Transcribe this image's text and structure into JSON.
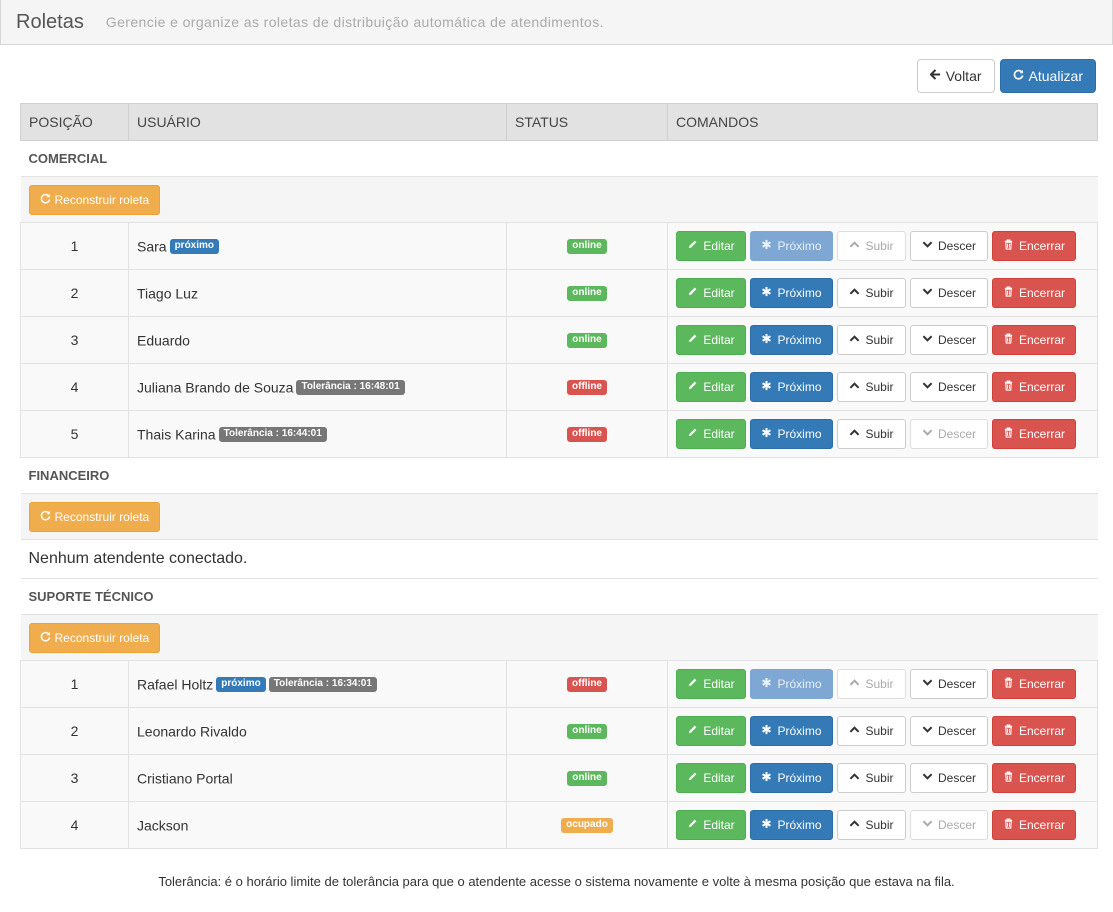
{
  "header": {
    "title": "Roletas",
    "subtitle": "Gerencie e organize as roletas de distribuição automática de atendimentos."
  },
  "toolbar": {
    "back_label": "Voltar",
    "refresh_label": "Atualizar"
  },
  "table": {
    "columns": [
      "POSIÇÃO",
      "USUÁRIO",
      "STATUS",
      "COMANDOS"
    ],
    "rebuild_label": "Reconstruir roleta",
    "empty_message": "Nenhum atendente conectado.",
    "commands": {
      "edit": "Editar",
      "next": "Próximo",
      "up": "Subir",
      "down": "Descer",
      "end": "Encerrar"
    }
  },
  "groups": [
    {
      "name": "COMERCIAL",
      "users": [
        {
          "pos": "1",
          "name": "Sara",
          "next_badge": "próximo",
          "tolerance": "",
          "status": "online",
          "next_disabled": true,
          "up_disabled": true,
          "down_disabled": false
        },
        {
          "pos": "2",
          "name": "Tiago Luz",
          "next_badge": "",
          "tolerance": "",
          "status": "online",
          "next_disabled": false,
          "up_disabled": false,
          "down_disabled": false
        },
        {
          "pos": "3",
          "name": "Eduardo",
          "next_badge": "",
          "tolerance": "",
          "status": "online",
          "next_disabled": false,
          "up_disabled": false,
          "down_disabled": false
        },
        {
          "pos": "4",
          "name": "Juliana Brando de Souza",
          "next_badge": "",
          "tolerance": "Tolerância : 16:48:01",
          "status": "offline",
          "next_disabled": false,
          "up_disabled": false,
          "down_disabled": false
        },
        {
          "pos": "5",
          "name": "Thais Karina",
          "next_badge": "",
          "tolerance": "Tolerância : 16:44:01",
          "status": "offline",
          "next_disabled": false,
          "up_disabled": false,
          "down_disabled": true
        }
      ]
    },
    {
      "name": "FINANCEIRO",
      "users": []
    },
    {
      "name": "SUPORTE TÉCNICO",
      "users": [
        {
          "pos": "1",
          "name": "Rafael Holtz",
          "next_badge": "próximo",
          "tolerance": "Tolerância : 16:34:01",
          "status": "offline",
          "next_disabled": true,
          "up_disabled": true,
          "down_disabled": false
        },
        {
          "pos": "2",
          "name": "Leonardo Rivaldo",
          "next_badge": "",
          "tolerance": "",
          "status": "online",
          "next_disabled": false,
          "up_disabled": false,
          "down_disabled": false
        },
        {
          "pos": "3",
          "name": "Cristiano Portal",
          "next_badge": "",
          "tolerance": "",
          "status": "online",
          "next_disabled": false,
          "up_disabled": false,
          "down_disabled": false
        },
        {
          "pos": "4",
          "name": "Jackson",
          "next_badge": "",
          "tolerance": "",
          "status": "ocupado",
          "next_disabled": false,
          "up_disabled": false,
          "down_disabled": true
        }
      ]
    }
  ],
  "footnote": "Tolerância: é o horário limite de tolerância para que o atendente acesse o sistema novamente e volte à mesma posição que estava na fila.",
  "colors": {
    "primary": "#337ab7",
    "success": "#5cb85c",
    "warning": "#f0ad4e",
    "danger": "#d9534f",
    "muted": "#777777"
  },
  "icons": {
    "back": "arrow-left-icon",
    "refresh": "refresh-icon",
    "edit": "pencil-icon",
    "next": "asterisk-icon",
    "up": "chevron-up-icon",
    "down": "chevron-down-icon",
    "end": "trash-icon"
  }
}
